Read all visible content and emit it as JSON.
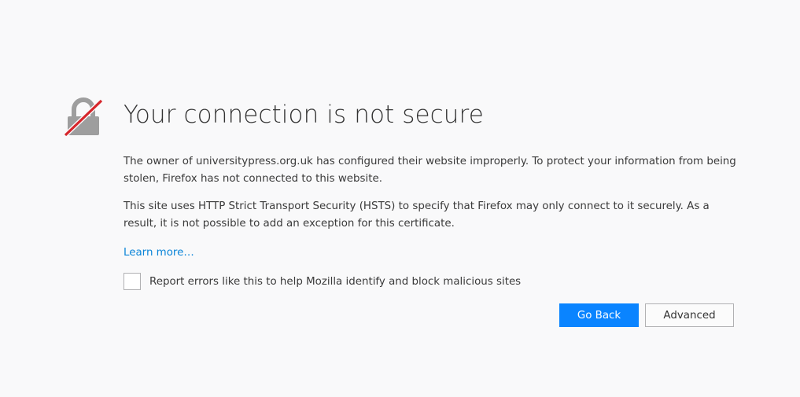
{
  "error_page": {
    "title": "Your connection is not secure",
    "description_1": "The owner of universitypress.org.uk has configured their website improperly. To protect your information from being stolen, Firefox has not connected to this website.",
    "description_2": "This site uses HTTP Strict Transport Security (HSTS) to specify that Firefox may only connect to it securely. As a result, it is not possible to add an exception for this certificate.",
    "learn_more": "Learn more…",
    "report_checkbox": {
      "label": "Report errors like this to help Mozilla identify and block malicious sites",
      "checked": false
    },
    "buttons": {
      "go_back": "Go Back",
      "advanced": "Advanced"
    },
    "icon": "broken-lock-icon"
  },
  "colors": {
    "background": "#f9f9fa",
    "primary_button": "#0a84ff",
    "link": "#0a84d8",
    "lock_gray": "#b1b1b3",
    "strike_red": "#d6262b"
  }
}
